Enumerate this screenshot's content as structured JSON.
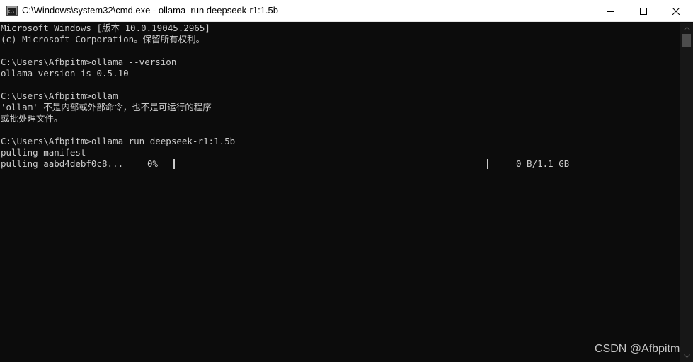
{
  "window": {
    "title": "C:\\Windows\\system32\\cmd.exe - ollama  run deepseek-r1:1.5b",
    "icon": "cmd-icon"
  },
  "caption_buttons": {
    "minimize_icon": "minimize-icon",
    "maximize_icon": "maximize-icon",
    "close_icon": "close-icon"
  },
  "console": {
    "lines": [
      "Microsoft Windows [版本 10.0.19045.2965]",
      "(c) Microsoft Corporation。保留所有权利。",
      "",
      "C:\\Users\\Afbpitm>ollama --version",
      "ollama version is 0.5.10",
      "",
      "C:\\Users\\Afbpitm>ollam",
      "'ollam' 不是内部或外部命令，也不是可运行的程序",
      "或批处理文件。",
      "",
      "C:\\Users\\Afbpitm>ollama run deepseek-r1:1.5b",
      "pulling manifest"
    ],
    "progress": {
      "label": "pulling aabd4debf0c8...",
      "percent_text": "0%",
      "fraction": 0.0,
      "size_text": "0 B/1.1 GB"
    },
    "text_color": "#cccccc",
    "background": "#0c0c0c"
  },
  "watermark": "CSDN @Afbpitm"
}
